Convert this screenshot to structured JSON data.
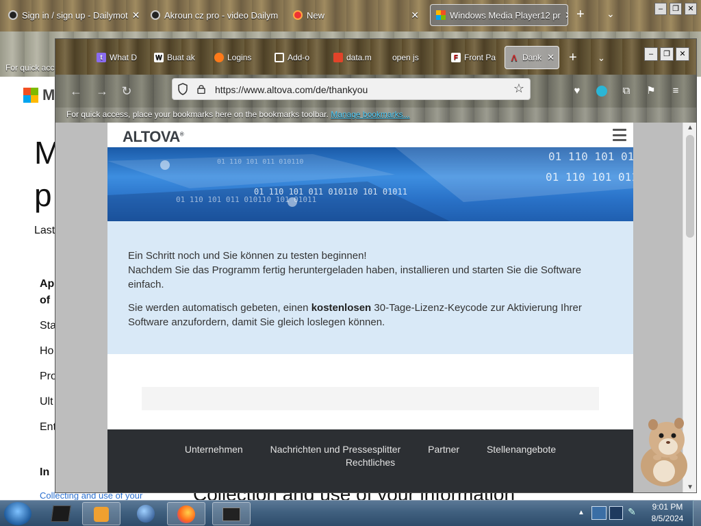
{
  "background_browser": {
    "tabs": [
      {
        "title": "Sign in / sign up - Dailymot"
      },
      {
        "title": "Akroun cz pro - video Dailym"
      },
      {
        "title": "New"
      },
      {
        "title": "Windows Media Player12 pr"
      }
    ],
    "bookmarks_hint": "For quick acc",
    "page": {
      "logo_letter": "M",
      "heading_line1": "M",
      "heading_line2": "p",
      "last_updated": "Last",
      "side_items": [
        "Ap",
        "of",
        "Sta",
        "Ho",
        "Pro",
        "Ult",
        "Ent",
        "In"
      ],
      "bottom_link": "Collecting and use of your",
      "bottom_heading": "Collection and use of your information"
    }
  },
  "foreground_browser": {
    "tabs": [
      {
        "title": "What D"
      },
      {
        "title": "Buat ak"
      },
      {
        "title": "Logins"
      },
      {
        "title": "Add-o"
      },
      {
        "title": "data.m"
      },
      {
        "title": "open js"
      },
      {
        "title": "Front Pa"
      },
      {
        "title": "Dank"
      }
    ],
    "url": "https://www.altova.com/de/thankyou",
    "bookmarks_toolbar": {
      "text": "For quick access, place your bookmarks here on the bookmarks toolbar.",
      "link": "Manage bookmarks..."
    }
  },
  "altova_page": {
    "logo": "ALTOVA",
    "logo_mark": "®",
    "banner_text": [
      "01 110 101 01",
      "01 110 101 011",
      "01 110 101 011 010110 101 01011",
      "01 110 101 011 010110",
      "01 110 101 011 010110 101 01011"
    ],
    "message": {
      "line1": "Ein Schritt noch und Sie können zu testen beginnen!",
      "line2": "Nachdem Sie das Programm fertig heruntergeladen haben, installieren und starten Sie die Software einfach.",
      "p2_before": "Sie werden automatisch gebeten, einen ",
      "p2_bold": "kostenlosen",
      "p2_after": " 30-Tage-Lizenz-Keycode zur Aktivierung Ihrer Software anzufordern, damit Sie gleich loslegen können."
    },
    "footer_links": [
      "Unternehmen",
      "Nachrichten und Pressesplitter",
      "Partner",
      "Stellenangebote",
      "Rechtliches"
    ]
  },
  "taskbar": {
    "time": "9:01 PM",
    "date": "8/5/2024"
  },
  "colors": {
    "banner_blue": "#2a72c8",
    "info_box": "#d9e9f7",
    "footer_dark": "#2c2f33"
  }
}
